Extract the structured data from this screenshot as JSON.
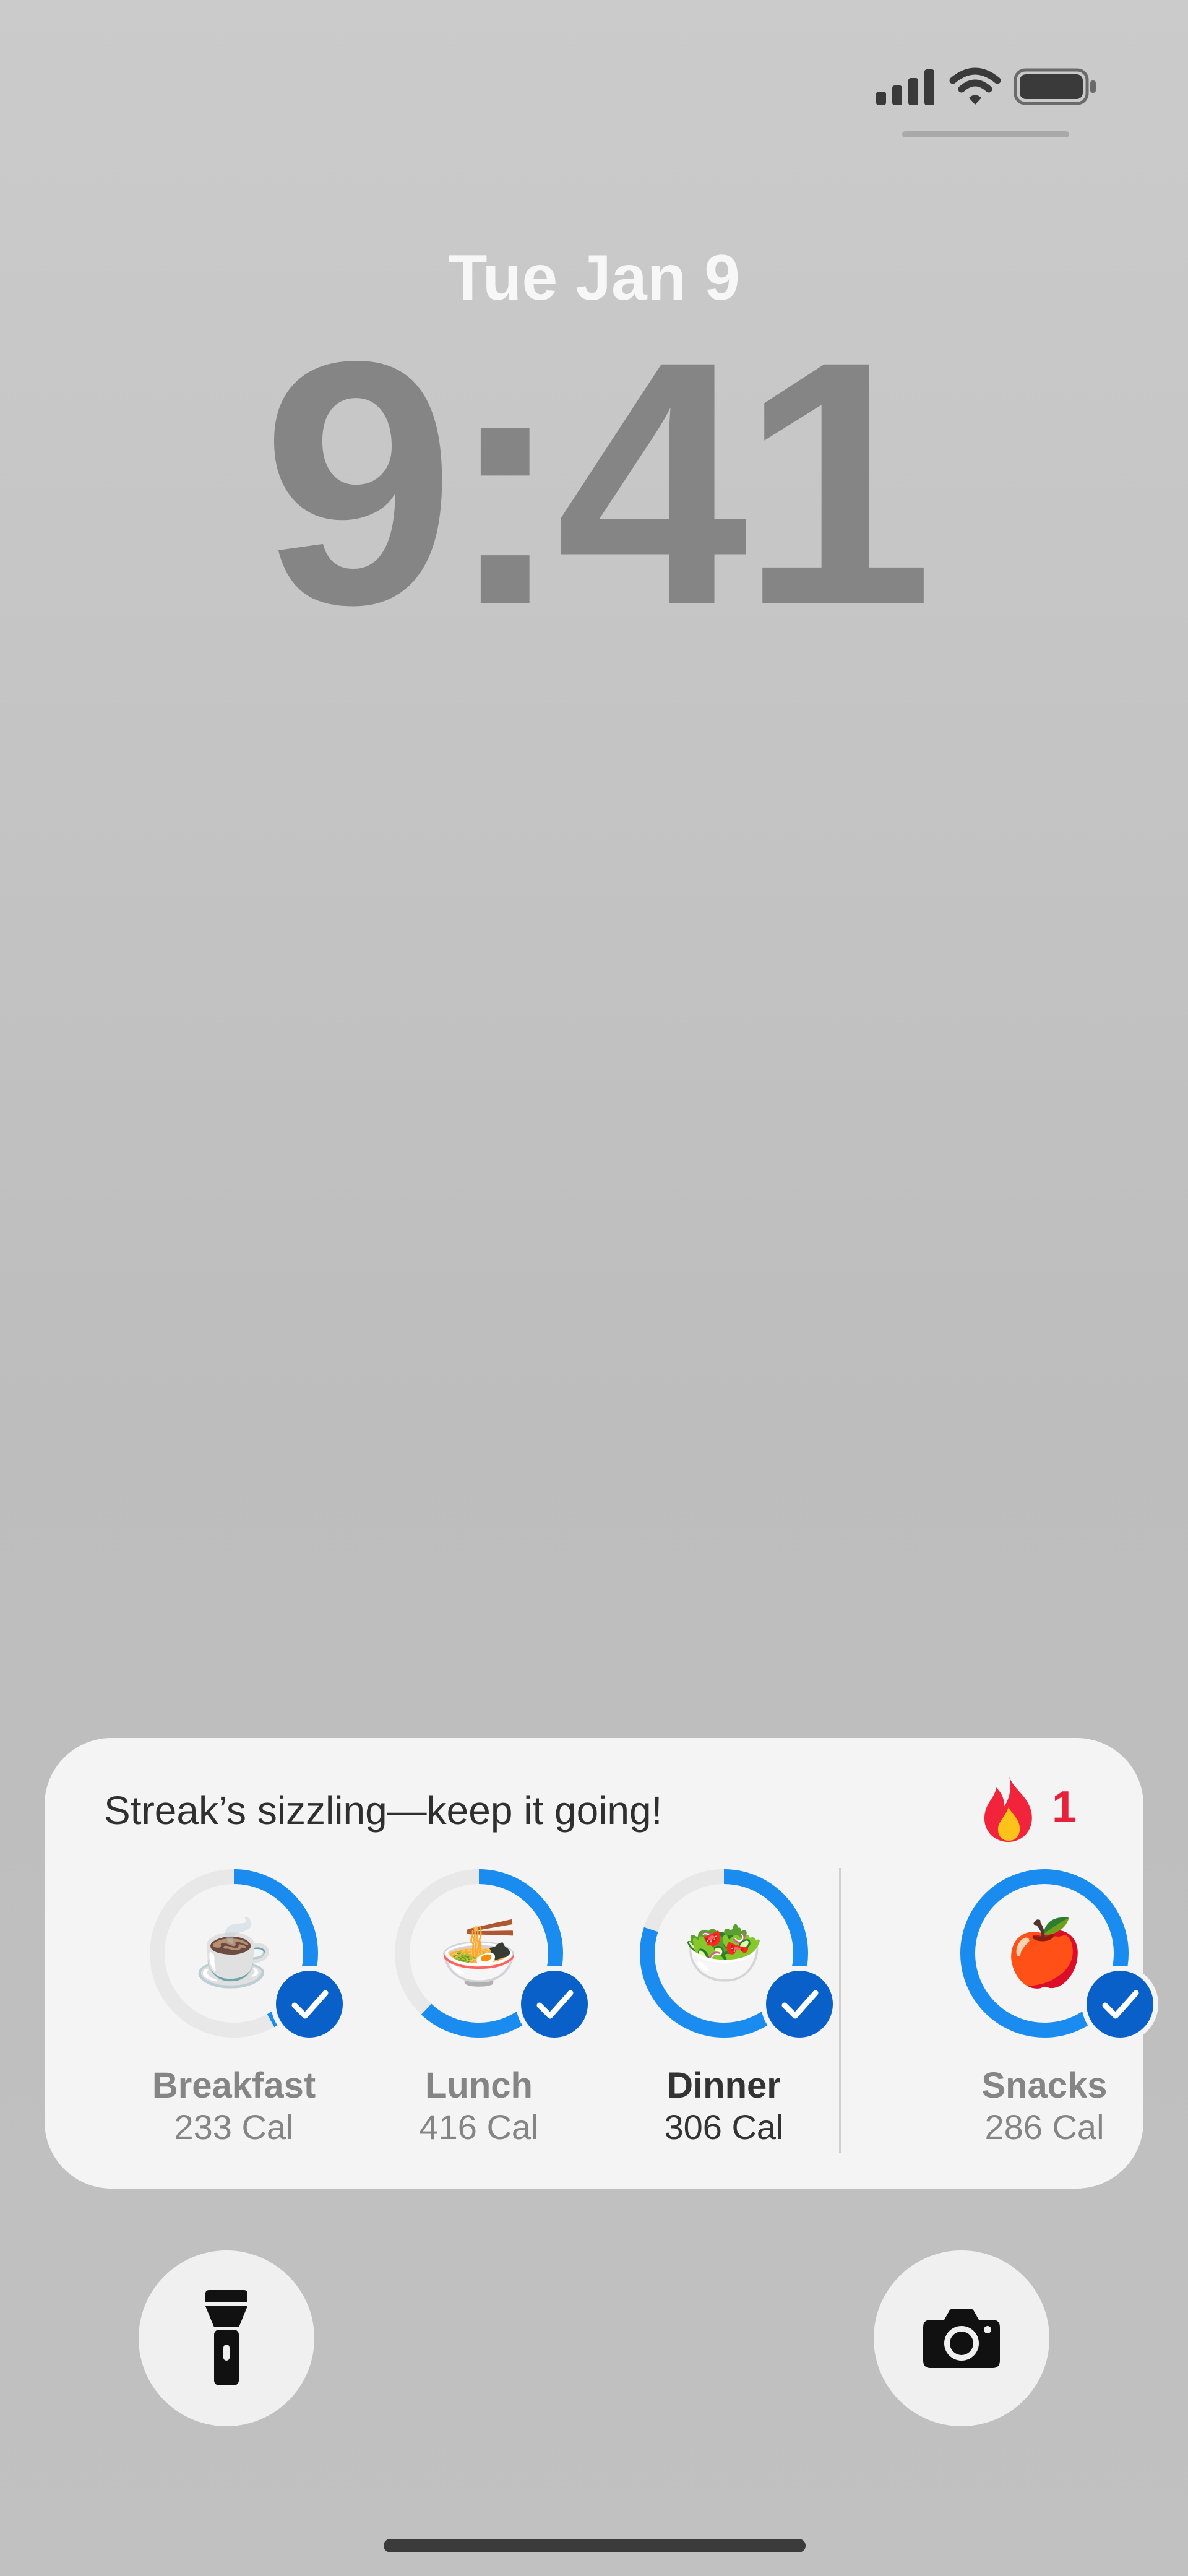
{
  "lockscreen": {
    "date": "Tue Jan 9",
    "time": "9:41"
  },
  "status_bar": {
    "signal_icon": "cellular-signal-icon",
    "wifi_icon": "wifi-icon",
    "battery_icon": "battery-icon"
  },
  "widget": {
    "headline": "Streak’s sizzling—keep it going!",
    "streak": {
      "icon": "flame-icon",
      "count": "1",
      "color": "#e8213b"
    },
    "ring_color": "#1a8cf0",
    "check_color": "#0a60c9",
    "meals": [
      {
        "label": "Breakfast",
        "calories": "233 Cal",
        "icon": "coffee-cup-icon",
        "progress": 0.42,
        "logged": true
      },
      {
        "label": "Lunch",
        "calories": "416 Cal",
        "icon": "bowl-icon",
        "progress": 0.62,
        "logged": true
      },
      {
        "label": "Dinner",
        "calories": "306 Cal",
        "icon": "salad-icon",
        "progress": 0.8,
        "logged": true
      },
      {
        "label": "Snacks",
        "calories": "286 Cal",
        "icon": "apple-icon",
        "progress": 1.0,
        "logged": true
      }
    ]
  },
  "actions": {
    "flashlight_icon": "flashlight-icon",
    "camera_icon": "camera-icon"
  }
}
